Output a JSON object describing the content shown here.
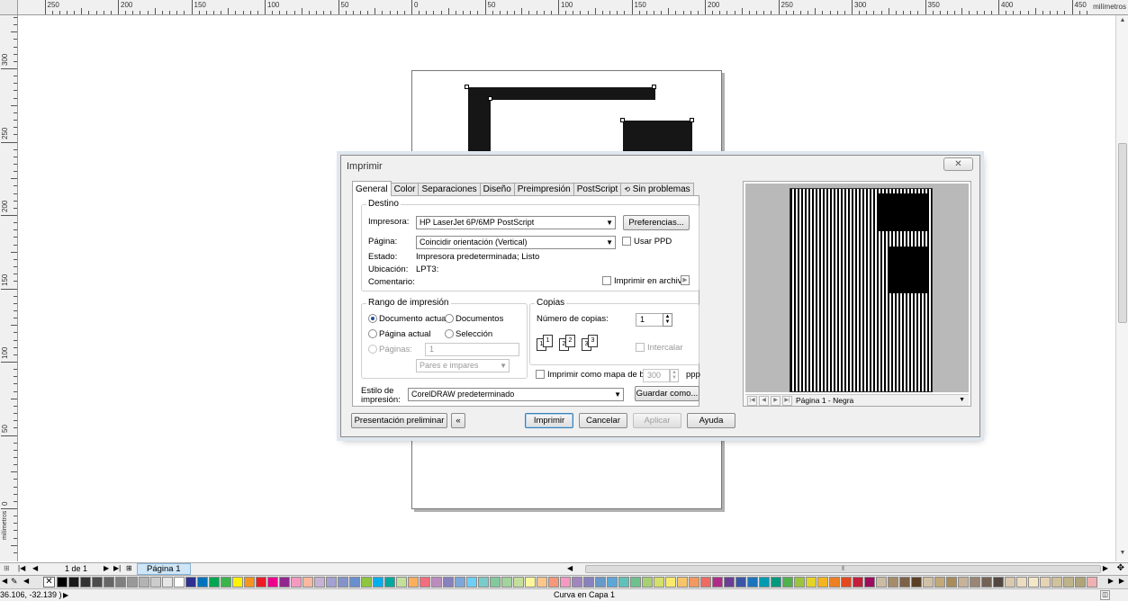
{
  "ruler": {
    "top_labels": [
      "250",
      "200",
      "150",
      "100",
      "50",
      "0",
      "50",
      "100",
      "150",
      "200",
      "250",
      "300",
      "350",
      "400",
      "450"
    ],
    "left_labels": [
      "300",
      "250",
      "200",
      "150",
      "100",
      "50",
      "0"
    ],
    "unit": "milímetros",
    "unit_side": "milímetros"
  },
  "dialog": {
    "title": "Imprimir",
    "close_glyph": "✕",
    "tabs": [
      {
        "label": "General"
      },
      {
        "label": "Color"
      },
      {
        "label": "Separaciones"
      },
      {
        "label": "Diseño"
      },
      {
        "label": "Preimpresión"
      },
      {
        "label": "PostScript"
      },
      {
        "label": "Sin problemas"
      }
    ],
    "destino": {
      "title": "Destino",
      "printer_label": "Impresora:",
      "printer_value": "HP LaserJet 6P/6MP PostScript",
      "preferences_button": "Preferencias...",
      "page_label": "Página:",
      "page_value": "Coincidir orientación (Vertical)",
      "use_ppd_label": "Usar PPD",
      "status_label": "Estado:",
      "status_value": "Impresora predeterminada; Listo",
      "location_label": "Ubicación:",
      "location_value": "LPT3:",
      "comment_label": "Comentario:",
      "print_to_file_label": "Imprimir en archivo"
    },
    "range": {
      "title": "Rango de impresión",
      "current_document": "Documento actual",
      "documents": "Documentos",
      "current_page": "Página actual",
      "selection": "Selección",
      "pages_label": "Páginas:",
      "pages_value": "1",
      "even_odd": "Pares e impares"
    },
    "copies": {
      "title": "Copias",
      "number_label": "Número de copias:",
      "number_value": "1",
      "collate_label": "Intercalar",
      "icon_numbers": [
        "1",
        "1",
        "2",
        "2",
        "3",
        "3"
      ]
    },
    "bitmap": {
      "label": "Imprimir como mapa de bits:",
      "value": "300",
      "unit": "ppp"
    },
    "style": {
      "label_line1": "Estilo de",
      "label_line2": "impresión:",
      "value": "CorelDRAW predeterminado",
      "save_as_button": "Guardar como..."
    },
    "buttons": {
      "preview": "Presentación preliminar",
      "collapse": "«",
      "print": "Imprimir",
      "cancel": "Cancelar",
      "apply": "Aplicar",
      "help": "Ayuda"
    },
    "preview_pane": {
      "page_combo": "Página 1 - Negra"
    }
  },
  "page_nav": {
    "page_count": "1 de 1",
    "page_tab": "Página 1"
  },
  "palette": {
    "colors": [
      "#000000",
      "#1a1a1a",
      "#333333",
      "#4d4d4d",
      "#666666",
      "#808080",
      "#999999",
      "#b3b3b3",
      "#cccccc",
      "#e6e6e6",
      "#ffffff",
      "#2e3192",
      "#0072bc",
      "#00a651",
      "#39b54a",
      "#fff200",
      "#f7941d",
      "#ed1c24",
      "#ec008c",
      "#92278f",
      "#f49ac1",
      "#f9b8a0",
      "#c7b2d6",
      "#a3a0d2",
      "#8393ca",
      "#6a8fcf",
      "#8dc63f",
      "#00aeef",
      "#00a99d",
      "#c4df9b",
      "#fbaf5d",
      "#f26d7d",
      "#bd8cbf",
      "#8781bd",
      "#7da7d9",
      "#6dcff6",
      "#7accc8",
      "#82ca9c",
      "#a3d39c",
      "#c4df9b",
      "#fff799",
      "#fdc68a",
      "#f7977a",
      "#f49ac2",
      "#a186be",
      "#8882be",
      "#6799c9",
      "#5ca7d6",
      "#5fc2b8",
      "#6cc18d",
      "#a7d073",
      "#d5e06a",
      "#f9ea6b",
      "#f8c46b",
      "#f2995f",
      "#ee6a63",
      "#b12a89",
      "#6b3e95",
      "#3a56a6",
      "#1c75bc",
      "#009bb0",
      "#009a7c",
      "#4fb24d",
      "#9bc53d",
      "#e3d327",
      "#f5b41f",
      "#ee7f22",
      "#e4481f",
      "#c41e3a",
      "#9e0b5f",
      "#ccbba3",
      "#a68c6b",
      "#7d6247",
      "#594024",
      "#d1c0a5",
      "#c2a878",
      "#a88d5a",
      "#c7b299",
      "#998675",
      "#736357",
      "#534741",
      "#d9c8ad",
      "#ecdcc0",
      "#f5e6c8",
      "#e6d3b5",
      "#cfc29c",
      "#bfb38a",
      "#afa37a",
      "#efb1b1",
      "#e69b9b",
      "#d48b8b",
      "#f7c6c6",
      "#e06666",
      "#cc4444",
      "#ff8080",
      "#ff6666",
      "#e85d75",
      "#f06292",
      "#e57373",
      "#ef9a9a",
      "#f48fb1",
      "#ce93d8",
      "#b39ddb",
      "#9fa8da",
      "#90caf9",
      "#81d4fa",
      "#80deea",
      "#80cbc4",
      "#a5d6a7",
      "#c5e1a5",
      "#e6ee9c",
      "#fff59d",
      "#ffe082",
      "#ffcc80",
      "#ffab91"
    ]
  },
  "status": {
    "coords": "36.106, -32.139 )",
    "arrow": "▶",
    "message": "Curva en Capa 1"
  }
}
